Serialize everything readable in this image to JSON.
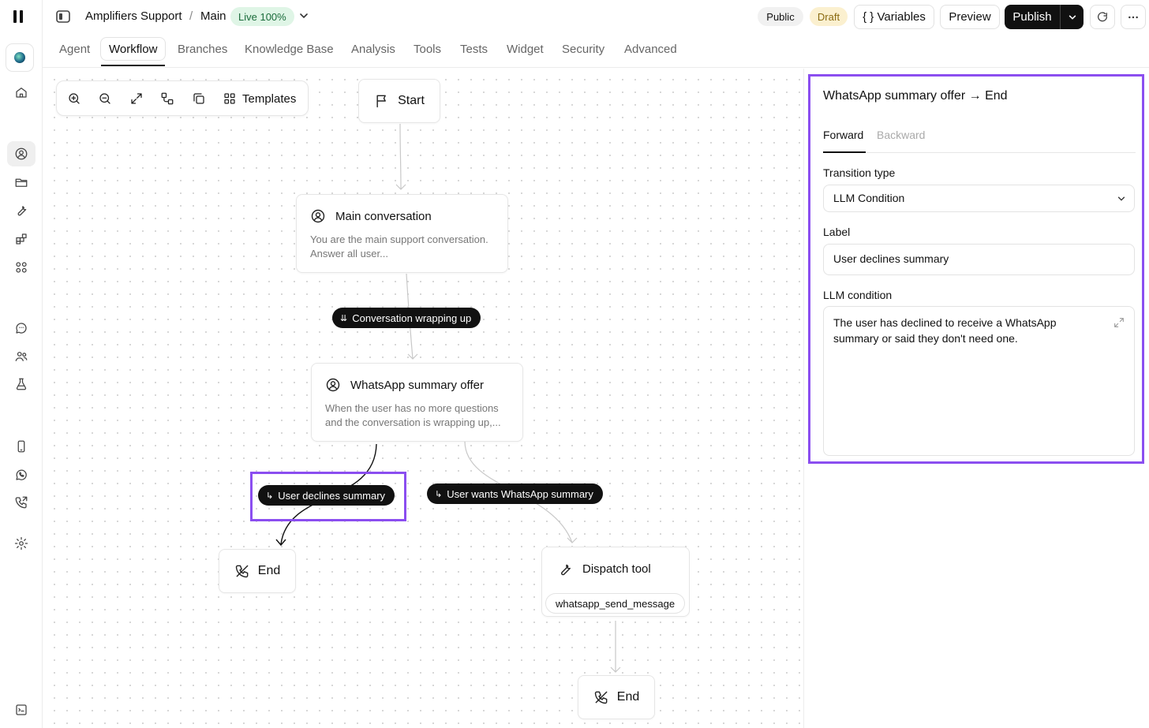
{
  "topbar": {
    "breadcrumb_project": "Amplifiers Support",
    "breadcrumb_sep": "/",
    "breadcrumb_branch": "Main",
    "live_badge": "Live 100%",
    "public_badge": "Public",
    "draft_badge": "Draft",
    "variables_label": "{ } Variables",
    "preview_label": "Preview",
    "publish_label": "Publish"
  },
  "tabs": [
    "Agent",
    "Workflow",
    "Branches",
    "Knowledge Base",
    "Analysis",
    "Tools",
    "Tests",
    "Widget",
    "Security",
    "Advanced"
  ],
  "active_tab": "Workflow",
  "toolbar": {
    "templates_label": "Templates"
  },
  "nodes": {
    "start": {
      "label": "Start"
    },
    "main": {
      "title": "Main conversation",
      "desc": "You are the main support conversation. Answer all user..."
    },
    "whatsapp": {
      "title": "WhatsApp summary offer",
      "desc": "When the user has no more questions and the conversation is wrapping up,..."
    },
    "end_left": {
      "label": "End"
    },
    "dispatch": {
      "title": "Dispatch tool",
      "chip": "whatsapp_send_message"
    },
    "end_bottom": {
      "label": "End"
    }
  },
  "edges": {
    "wrapping": "Conversation wrapping up",
    "declines": "User declines summary",
    "wants": "User wants WhatsApp summary"
  },
  "panel": {
    "title": "WhatsApp summary offer → End",
    "tab_forward": "Forward",
    "tab_backward": "Backward",
    "transition_type_label": "Transition type",
    "transition_type_value": "LLM Condition",
    "label_label": "Label",
    "label_value": "User declines summary",
    "llm_condition_label": "LLM condition",
    "llm_condition_value": "The user has declined to receive a WhatsApp summary or said they don't need one."
  },
  "colors": {
    "highlight": "#8b4ef0",
    "live_bg": "#dff5e6",
    "draft_bg": "#fbf0cf",
    "edge_label_bg": "#111111"
  }
}
